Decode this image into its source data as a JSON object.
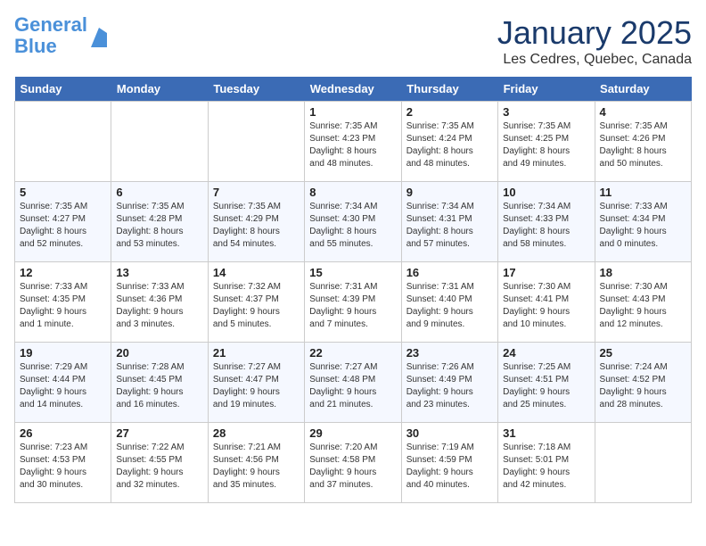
{
  "header": {
    "logo_line1": "General",
    "logo_line2": "Blue",
    "month_title": "January 2025",
    "location": "Les Cedres, Quebec, Canada"
  },
  "days_of_week": [
    "Sunday",
    "Monday",
    "Tuesday",
    "Wednesday",
    "Thursday",
    "Friday",
    "Saturday"
  ],
  "weeks": [
    [
      {
        "num": "",
        "info": ""
      },
      {
        "num": "",
        "info": ""
      },
      {
        "num": "",
        "info": ""
      },
      {
        "num": "1",
        "info": "Sunrise: 7:35 AM\nSunset: 4:23 PM\nDaylight: 8 hours\nand 48 minutes."
      },
      {
        "num": "2",
        "info": "Sunrise: 7:35 AM\nSunset: 4:24 PM\nDaylight: 8 hours\nand 48 minutes."
      },
      {
        "num": "3",
        "info": "Sunrise: 7:35 AM\nSunset: 4:25 PM\nDaylight: 8 hours\nand 49 minutes."
      },
      {
        "num": "4",
        "info": "Sunrise: 7:35 AM\nSunset: 4:26 PM\nDaylight: 8 hours\nand 50 minutes."
      }
    ],
    [
      {
        "num": "5",
        "info": "Sunrise: 7:35 AM\nSunset: 4:27 PM\nDaylight: 8 hours\nand 52 minutes."
      },
      {
        "num": "6",
        "info": "Sunrise: 7:35 AM\nSunset: 4:28 PM\nDaylight: 8 hours\nand 53 minutes."
      },
      {
        "num": "7",
        "info": "Sunrise: 7:35 AM\nSunset: 4:29 PM\nDaylight: 8 hours\nand 54 minutes."
      },
      {
        "num": "8",
        "info": "Sunrise: 7:34 AM\nSunset: 4:30 PM\nDaylight: 8 hours\nand 55 minutes."
      },
      {
        "num": "9",
        "info": "Sunrise: 7:34 AM\nSunset: 4:31 PM\nDaylight: 8 hours\nand 57 minutes."
      },
      {
        "num": "10",
        "info": "Sunrise: 7:34 AM\nSunset: 4:33 PM\nDaylight: 8 hours\nand 58 minutes."
      },
      {
        "num": "11",
        "info": "Sunrise: 7:33 AM\nSunset: 4:34 PM\nDaylight: 9 hours\nand 0 minutes."
      }
    ],
    [
      {
        "num": "12",
        "info": "Sunrise: 7:33 AM\nSunset: 4:35 PM\nDaylight: 9 hours\nand 1 minute."
      },
      {
        "num": "13",
        "info": "Sunrise: 7:33 AM\nSunset: 4:36 PM\nDaylight: 9 hours\nand 3 minutes."
      },
      {
        "num": "14",
        "info": "Sunrise: 7:32 AM\nSunset: 4:37 PM\nDaylight: 9 hours\nand 5 minutes."
      },
      {
        "num": "15",
        "info": "Sunrise: 7:31 AM\nSunset: 4:39 PM\nDaylight: 9 hours\nand 7 minutes."
      },
      {
        "num": "16",
        "info": "Sunrise: 7:31 AM\nSunset: 4:40 PM\nDaylight: 9 hours\nand 9 minutes."
      },
      {
        "num": "17",
        "info": "Sunrise: 7:30 AM\nSunset: 4:41 PM\nDaylight: 9 hours\nand 10 minutes."
      },
      {
        "num": "18",
        "info": "Sunrise: 7:30 AM\nSunset: 4:43 PM\nDaylight: 9 hours\nand 12 minutes."
      }
    ],
    [
      {
        "num": "19",
        "info": "Sunrise: 7:29 AM\nSunset: 4:44 PM\nDaylight: 9 hours\nand 14 minutes."
      },
      {
        "num": "20",
        "info": "Sunrise: 7:28 AM\nSunset: 4:45 PM\nDaylight: 9 hours\nand 16 minutes."
      },
      {
        "num": "21",
        "info": "Sunrise: 7:27 AM\nSunset: 4:47 PM\nDaylight: 9 hours\nand 19 minutes."
      },
      {
        "num": "22",
        "info": "Sunrise: 7:27 AM\nSunset: 4:48 PM\nDaylight: 9 hours\nand 21 minutes."
      },
      {
        "num": "23",
        "info": "Sunrise: 7:26 AM\nSunset: 4:49 PM\nDaylight: 9 hours\nand 23 minutes."
      },
      {
        "num": "24",
        "info": "Sunrise: 7:25 AM\nSunset: 4:51 PM\nDaylight: 9 hours\nand 25 minutes."
      },
      {
        "num": "25",
        "info": "Sunrise: 7:24 AM\nSunset: 4:52 PM\nDaylight: 9 hours\nand 28 minutes."
      }
    ],
    [
      {
        "num": "26",
        "info": "Sunrise: 7:23 AM\nSunset: 4:53 PM\nDaylight: 9 hours\nand 30 minutes."
      },
      {
        "num": "27",
        "info": "Sunrise: 7:22 AM\nSunset: 4:55 PM\nDaylight: 9 hours\nand 32 minutes."
      },
      {
        "num": "28",
        "info": "Sunrise: 7:21 AM\nSunset: 4:56 PM\nDaylight: 9 hours\nand 35 minutes."
      },
      {
        "num": "29",
        "info": "Sunrise: 7:20 AM\nSunset: 4:58 PM\nDaylight: 9 hours\nand 37 minutes."
      },
      {
        "num": "30",
        "info": "Sunrise: 7:19 AM\nSunset: 4:59 PM\nDaylight: 9 hours\nand 40 minutes."
      },
      {
        "num": "31",
        "info": "Sunrise: 7:18 AM\nSunset: 5:01 PM\nDaylight: 9 hours\nand 42 minutes."
      },
      {
        "num": "",
        "info": ""
      }
    ]
  ]
}
